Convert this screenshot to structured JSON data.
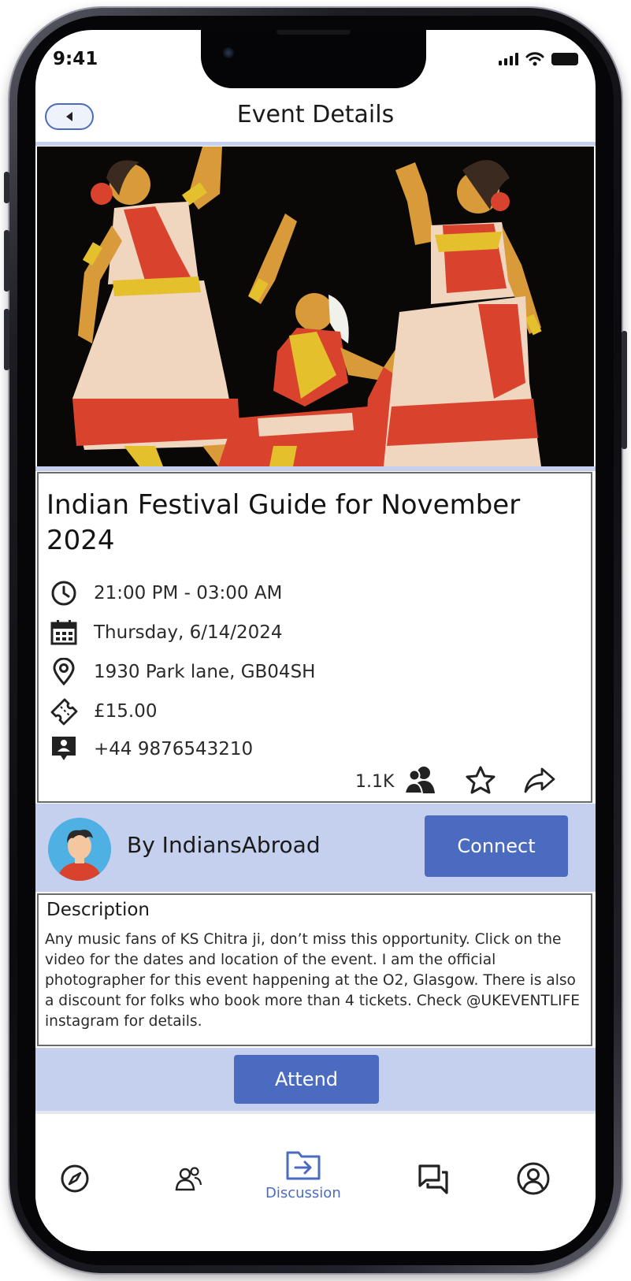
{
  "status_bar": {
    "time": "9:41"
  },
  "header": {
    "title": "Event Details",
    "back_icon": "back-arrow-icon"
  },
  "hero": {
    "image": "illustration of three classical Indian dancers",
    "colors": {
      "background": "#0a0806",
      "skin": "#d99a3a",
      "fabric_red": "#d9432e",
      "fabric_cream": "#f1d6bf",
      "gold": "#e4c02c"
    }
  },
  "event": {
    "title": "Indian Festival Guide for November 2024",
    "time": "21:00 PM - 03:00 AM",
    "date": "Thursday, 6/14/2024",
    "location": "1930 Park lane, GB04SH",
    "price": "£15.00",
    "contact": "+44 9876543210",
    "attendee_count": "1.1K"
  },
  "organizer": {
    "name": "By IndiansAbroad",
    "connect_label": "Connect"
  },
  "description": {
    "title": "Description",
    "body": "Any music fans of KS Chitra ji, don’t miss this opportunity. Click on the video for the dates and location of the event. I am the official photographer for this event happening at the O2, Glasgow. There is also a discount for folks who book more than 4 tickets. Check @UKEVENTLIFE instagram for details."
  },
  "attend_label": "Attend",
  "tabs": [
    {
      "icon": "compass-icon",
      "label": ""
    },
    {
      "icon": "people-icon",
      "label": ""
    },
    {
      "icon": "folder-arrow-icon",
      "label": "Discussion",
      "active": true
    },
    {
      "icon": "chat-icon",
      "label": ""
    },
    {
      "icon": "profile-icon",
      "label": ""
    }
  ],
  "theme": {
    "accent": "#4a6bbf",
    "band": "#c4d0ee",
    "text": "#1a1a1a"
  }
}
